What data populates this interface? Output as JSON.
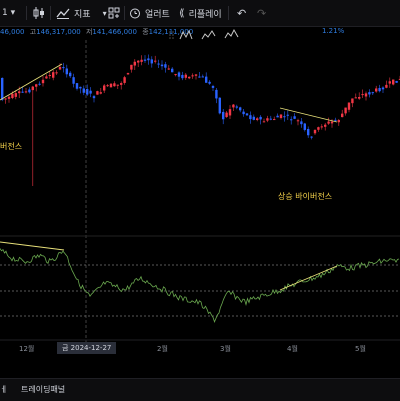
{
  "toolbar": {
    "indicators_label": "지표",
    "alert_label": "얼러트",
    "replay_label": "리플레이"
  },
  "ohlc": {
    "open_value": "46,000",
    "high_label": "고",
    "high_value": "146,317,000",
    "low_label": "저",
    "low_value": "141,466,000",
    "close_label": "종",
    "close_value": "142,111,000",
    "change_value": "1.21%"
  },
  "annotations": {
    "left_divergence": "버전스",
    "right_divergence": "상승 바이버전스"
  },
  "time_axis": {
    "labels": [
      "12월",
      "2월",
      "3월",
      "4월",
      "5월"
    ],
    "crosshair_date": "금 2024-12-27"
  },
  "bottom_panel": {
    "tab_left": "ㅔ",
    "tab_trading": "트레이딩패널"
  },
  "colors": {
    "up_candle": "#f23645",
    "down_candle": "#2962ff",
    "rsi_line": "#6aa84f",
    "divergence_line": "#e8e07a",
    "background": "#000000"
  }
}
